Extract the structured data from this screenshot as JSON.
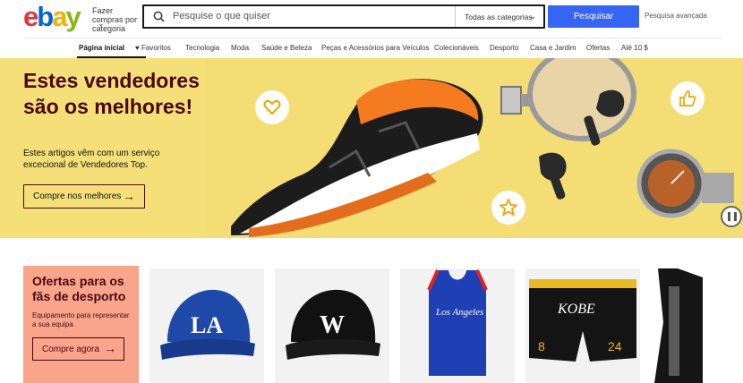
{
  "header": {
    "logo": {
      "e": "e",
      "b": "b",
      "a": "a",
      "y": "y"
    },
    "shop_by_category": "Fazer compras por categoria",
    "search_placeholder": "Pesquise o que quiser",
    "category_select": "Todas as categorias",
    "search_button": "Pesquisar",
    "advanced_search": "Pesquisa avançada"
  },
  "nav": {
    "items": [
      {
        "label": "Página inicial"
      },
      {
        "label": "Favoritos"
      },
      {
        "label": "Tecnologia"
      },
      {
        "label": "Moda"
      },
      {
        "label": "Saúde e Beleza"
      },
      {
        "label": "Peças e Acessórios para Veículos"
      },
      {
        "label": "Colecionáveis"
      },
      {
        "label": "Desporto"
      },
      {
        "label": "Casa e Jardim"
      },
      {
        "label": "Ofertas"
      },
      {
        "label": "Até 10 $"
      }
    ]
  },
  "hero": {
    "title": "Estes vendedores são os melhores!",
    "subtitle": "Estes artigos vêm com um serviço excecional de Vendedores Top.",
    "button": "Compre nos melhores",
    "background": "#f4dd75"
  },
  "deals": {
    "title": "Ofertas para os fãs de desporto",
    "subtitle": "Equipamento para representar a sua equipa",
    "button": "Compre agora",
    "background": "#f8a58b"
  },
  "products": [
    {
      "icon": "la-cap-icon"
    },
    {
      "icon": "nationals-cap-icon"
    },
    {
      "icon": "clippers-jersey-icon"
    },
    {
      "icon": "kobe-shorts-icon"
    },
    {
      "icon": "black-jacket-icon"
    }
  ],
  "colors": {
    "accent": "#3665f3",
    "maroon": "#4a0714"
  }
}
